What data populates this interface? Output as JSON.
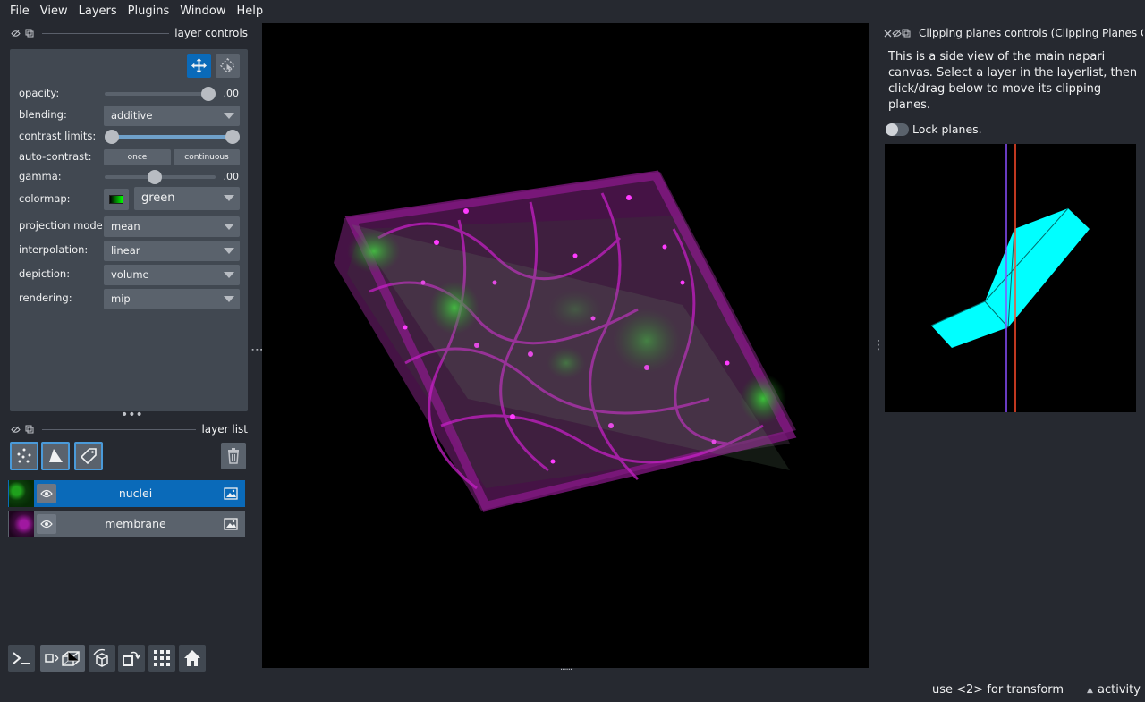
{
  "menubar": {
    "items": [
      "File",
      "View",
      "Layers",
      "Plugins",
      "Window",
      "Help"
    ]
  },
  "layer_controls": {
    "title": "layer controls",
    "opacity": {
      "label": "opacity:",
      "value": 1.0,
      "value_text": ".00"
    },
    "blending": {
      "label": "blending:",
      "value": "additive"
    },
    "contrast_limits": {
      "label": "contrast limits:",
      "low": 0.0,
      "high": 1.0
    },
    "auto_contrast": {
      "label": "auto-contrast:",
      "once": "once",
      "continuous": "continuous"
    },
    "gamma": {
      "label": "gamma:",
      "value": 1.0,
      "value_text": ".00"
    },
    "colormap": {
      "label": "colormap:",
      "value": "green"
    },
    "projection_mode": {
      "label": "projection mode:",
      "value": "mean"
    },
    "interpolation": {
      "label": "interpolation:",
      "value": "linear"
    },
    "depiction": {
      "label": "depiction:",
      "value": "volume"
    },
    "rendering": {
      "label": "rendering:",
      "value": "mip"
    }
  },
  "layer_list": {
    "title": "layer list",
    "layers": [
      {
        "name": "nuclei",
        "selected": true,
        "visible": true,
        "color": "#22c01e"
      },
      {
        "name": "membrane",
        "selected": false,
        "visible": true,
        "color": "#d41ed4"
      }
    ]
  },
  "clipping_panel": {
    "title": "Clipping planes controls (Clipping Planes C",
    "description": "This is a side view of the main napari canvas. Select a layer in the layerlist, then click/drag below to move its clipping planes.",
    "lock_label": "Lock planes.",
    "lock_on": false
  },
  "status": {
    "hint": "use <2> for transform",
    "activity": "activity"
  },
  "colors": {
    "accent": "#0a6ab9",
    "background": "#262930",
    "panel": "#414851",
    "control": "#5a626c",
    "plane_fill": "#00ffff",
    "plane_line_a": "#8a4fff",
    "plane_line_b": "#ff4b2b"
  }
}
